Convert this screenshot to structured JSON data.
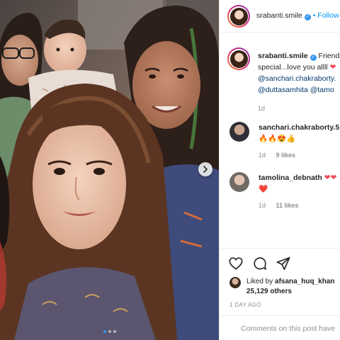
{
  "post": {
    "username": "srabanti.smile",
    "follow_label": "• Follow",
    "caption": {
      "line1": "Friend",
      "line2": "special...love you allll",
      "mention1": "@sanchari.chakraborty.",
      "mention2": "@duttasamhita",
      "mention3": "@tamo",
      "time": "1d"
    },
    "comments": [
      {
        "username": "sanchari.chakraborty.5",
        "emoji": "🔥🔥😍👍",
        "time": "1d",
        "likes": "9 likes"
      },
      {
        "username": "tamolina_debnath",
        "emoji": "❤️",
        "emoji_after": "❤️",
        "time": "1d",
        "likes": "11 likes"
      }
    ],
    "liked_by_prefix": "Liked by",
    "liked_by_user": "afsana_huq_khan",
    "liked_by_count": "25,129 others",
    "time_ago": "1 DAY AGO",
    "comment_placeholder": "Comments on this post have",
    "carousel_dots": 3,
    "carousel_active": 0
  },
  "colors": {
    "accent": "#0095f6",
    "verified": "#3897f0",
    "mention": "#00376b",
    "heart": "#ed4956",
    "meta": "#8e8e8e"
  },
  "icons": {
    "like": "heart-icon",
    "comment": "comment-icon",
    "share": "paper-plane-icon",
    "next": "chevron-right-icon"
  }
}
